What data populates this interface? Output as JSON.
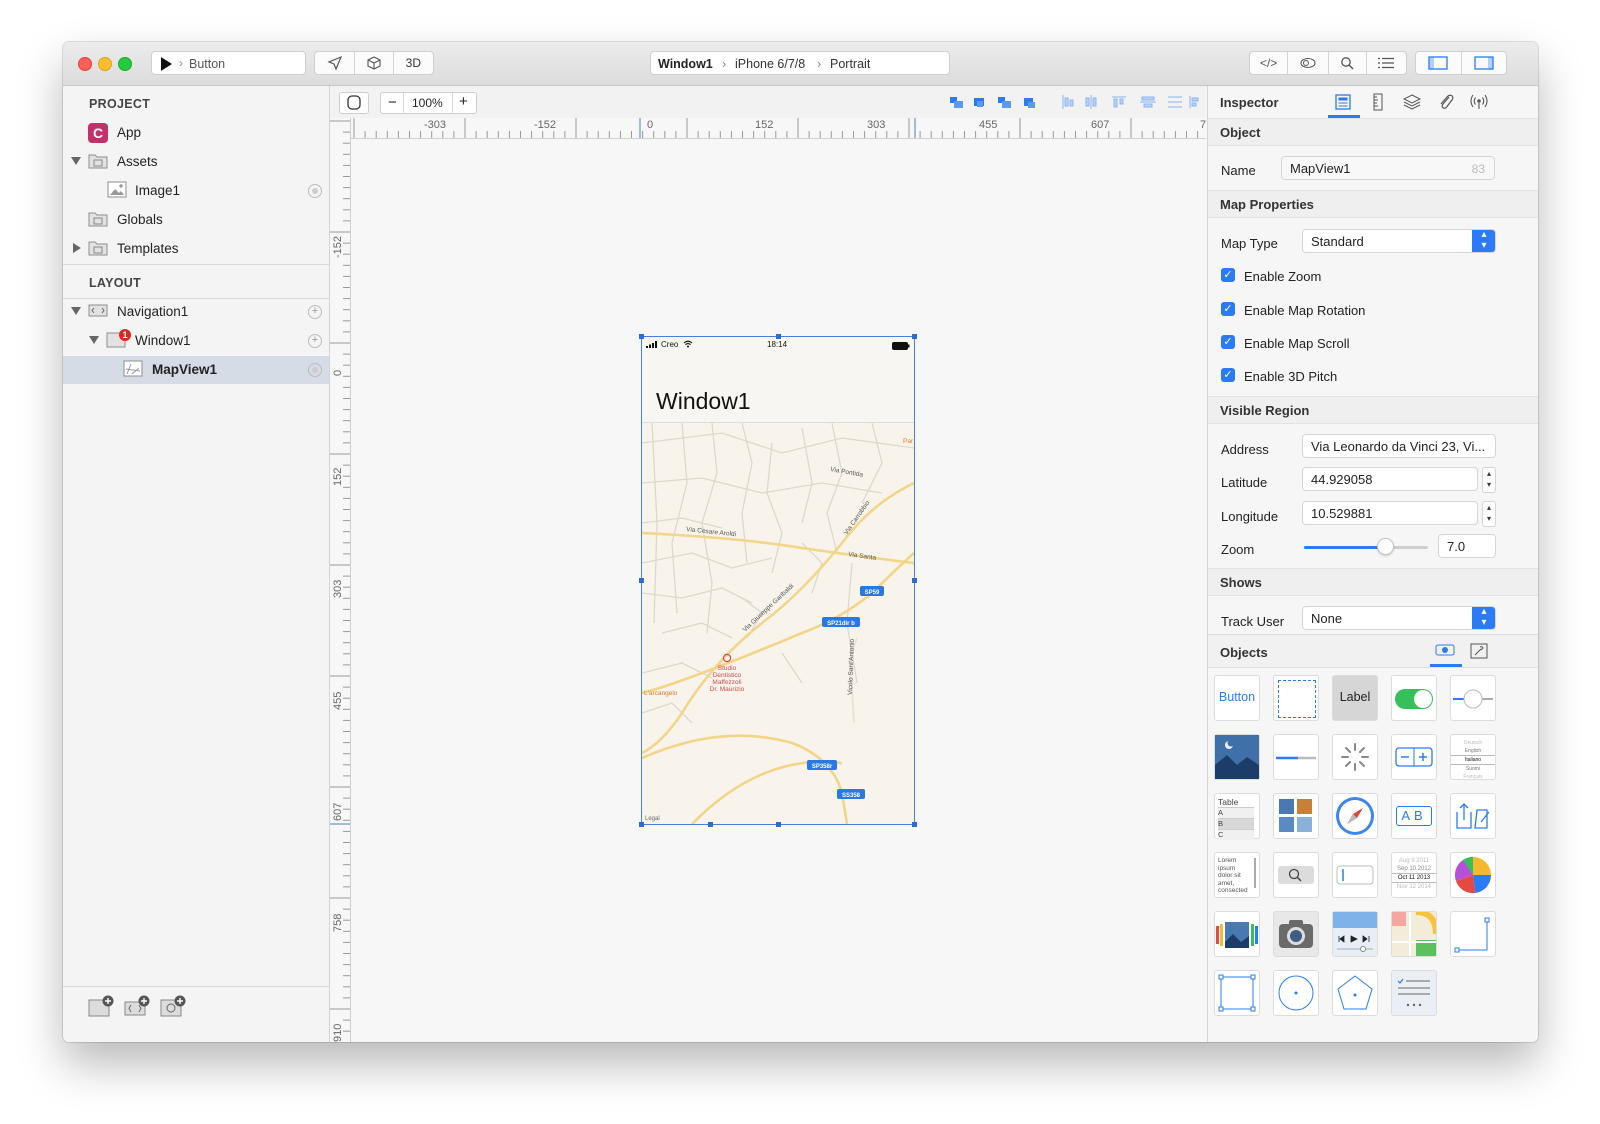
{
  "toolbar": {
    "scheme_label": "Button",
    "three_d_label": "3D",
    "breadcrumb": [
      "Window1",
      "iPhone 6/7/8",
      "Portrait"
    ]
  },
  "project": {
    "header": "PROJECT",
    "items": [
      {
        "label": "App"
      },
      {
        "label": "Assets"
      },
      {
        "label": "Image1"
      },
      {
        "label": "Globals"
      },
      {
        "label": "Templates"
      }
    ]
  },
  "layout": {
    "header": "LAYOUT",
    "items": [
      {
        "label": "Navigation1"
      },
      {
        "label": "Window1",
        "badge": "1"
      },
      {
        "label": "MapView1"
      }
    ]
  },
  "canvas": {
    "zoom": "100%",
    "ruler_h": [
      "-303",
      "-152",
      "0",
      "152",
      "303",
      "455",
      "607",
      "7"
    ],
    "ruler_v": [
      "-152",
      "0",
      "152",
      "303",
      "455",
      "607",
      "758",
      "910"
    ]
  },
  "phone": {
    "carrier": "Creo",
    "time": "18:14",
    "title": "Window1",
    "legal": "Legal",
    "map_labels": {
      "street1": "Via Cesare Aroldi",
      "street2": "Via Carrobbio",
      "street3": "Via Santa",
      "street4": "Via Pontida",
      "street5": "Via Giuseppe Garibaldi",
      "street6": "Vicolo Sant'Antonio",
      "poi": "Studio Dentistico Maffezzoli Dr. Maurizio",
      "place": "L'arcangelo",
      "edge": "Par",
      "shield1": "SP59",
      "shield2": "SP21dir b",
      "shield3": "SP358r",
      "shield4": "SS358"
    }
  },
  "inspector": {
    "title": "Inspector",
    "object_section": "Object",
    "name_label": "Name",
    "name_value": "MapView1",
    "name_counter": "83",
    "map_section": "Map Properties",
    "map_type_label": "Map Type",
    "map_type_value": "Standard",
    "checkboxes": [
      {
        "label": "Enable Zoom",
        "checked": true
      },
      {
        "label": "Enable Map Rotation",
        "checked": true
      },
      {
        "label": "Enable Map Scroll",
        "checked": true
      },
      {
        "label": "Enable 3D Pitch",
        "checked": true
      }
    ],
    "region_section": "Visible Region",
    "address_label": "Address",
    "address_value": "Via Leonardo da Vinci 23, Vi...",
    "latitude_label": "Latitude",
    "latitude_value": "44.929058",
    "longitude_label": "Longitude",
    "longitude_value": "10.529881",
    "zoom_label": "Zoom",
    "zoom_value": "7.0",
    "zoom_slider_fraction": 0.65,
    "shows_section": "Shows",
    "track_label": "Track User",
    "track_value": "None"
  },
  "objects": {
    "title": "Objects",
    "button_label": "Button",
    "label_label": "Label",
    "table_label": "Table",
    "table_rows": [
      "A",
      "B",
      "C"
    ],
    "lorem": "Lorem ipsum dolor sit amet, consected",
    "picker_items": [
      "Deutsch",
      "English",
      "Italiano",
      "Suomi",
      "Français"
    ],
    "date_items": [
      "Aug 9 2011",
      "Sep 10 2012",
      "Oct 11 2013",
      "Nov 12 2014"
    ],
    "ab": "AB"
  },
  "colors": {
    "accent": "#2a7bf5",
    "selection_border": "#4a7fd4",
    "map_bg": "#f8f4ec",
    "road": "#f5d98b",
    "badge": "#d62c20"
  }
}
